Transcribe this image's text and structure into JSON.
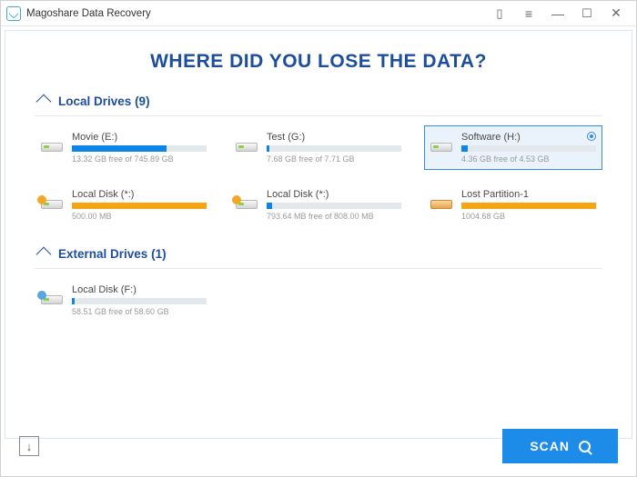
{
  "window": {
    "title": "Magoshare Data Recovery"
  },
  "heading": "WHERE DID YOU LOSE THE DATA?",
  "sections": {
    "local": {
      "title": "Local Drives",
      "count": "(9)"
    },
    "external": {
      "title": "External Drives",
      "count": "(1)"
    }
  },
  "local_drives": [
    {
      "name": "Movie (E:)",
      "detail": "13.32 GB free of 745.89 GB",
      "fill_pct": 70,
      "color": "blue",
      "warn": false,
      "lost": false,
      "selected": false
    },
    {
      "name": "Test (G:)",
      "detail": "7.68 GB free of 7.71 GB",
      "fill_pct": 2,
      "color": "blue",
      "warn": false,
      "lost": false,
      "selected": false
    },
    {
      "name": "Software (H:)",
      "detail": "4.36 GB free of 4.53 GB",
      "fill_pct": 5,
      "color": "blue",
      "warn": false,
      "lost": false,
      "selected": true
    },
    {
      "name": "Local Disk (*:)",
      "detail": "500.00 MB",
      "fill_pct": 100,
      "color": "orange",
      "warn": true,
      "lost": false,
      "selected": false
    },
    {
      "name": "Local Disk (*:)",
      "detail": "793.64 MB free of 808.00 MB",
      "fill_pct": 4,
      "color": "blue",
      "warn": true,
      "lost": false,
      "selected": false
    },
    {
      "name": "Lost Partition-1",
      "detail": "1004.68 GB",
      "fill_pct": 100,
      "color": "orange",
      "warn": false,
      "lost": true,
      "selected": false
    }
  ],
  "external_drives": [
    {
      "name": "Local Disk (F:)",
      "detail": "58.51 GB free of 58.60 GB",
      "fill_pct": 2,
      "color": "blue",
      "ext_badge": true,
      "selected": false
    }
  ],
  "footer": {
    "scan_label": "SCAN"
  }
}
